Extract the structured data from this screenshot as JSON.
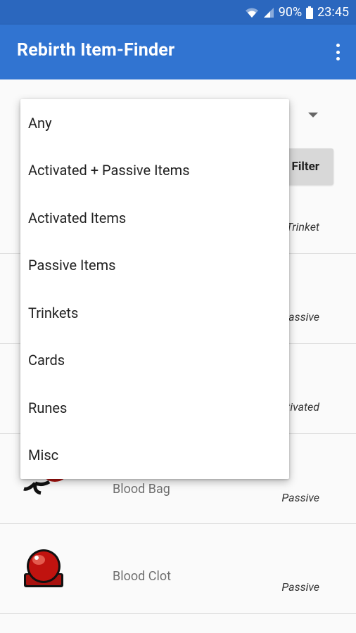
{
  "status_bar": {
    "battery": "90%",
    "time": "23:45",
    "icons": [
      "wifi-icon",
      "signal-icon",
      "battery-icon"
    ]
  },
  "app_bar": {
    "title": "Rebirth Item-Finder",
    "overflow_icon": "more-vert-icon"
  },
  "filter": {
    "button_label": "Filter"
  },
  "dropdown": {
    "options": [
      "Any",
      "Activated + Passive Items",
      "Activated Items",
      "Passive Items",
      "Trinkets",
      "Cards",
      "Runes",
      "Misc"
    ]
  },
  "items": [
    {
      "name": "",
      "type": "Trinket"
    },
    {
      "name": "",
      "type": "Passive"
    },
    {
      "name": "",
      "type": "Activated"
    },
    {
      "name": "Blood Bag",
      "type": "Passive"
    },
    {
      "name": "Blood Clot",
      "type": "Passive"
    }
  ],
  "colors": {
    "status_bar": "#2b67be",
    "app_bar": "#3174d1"
  }
}
